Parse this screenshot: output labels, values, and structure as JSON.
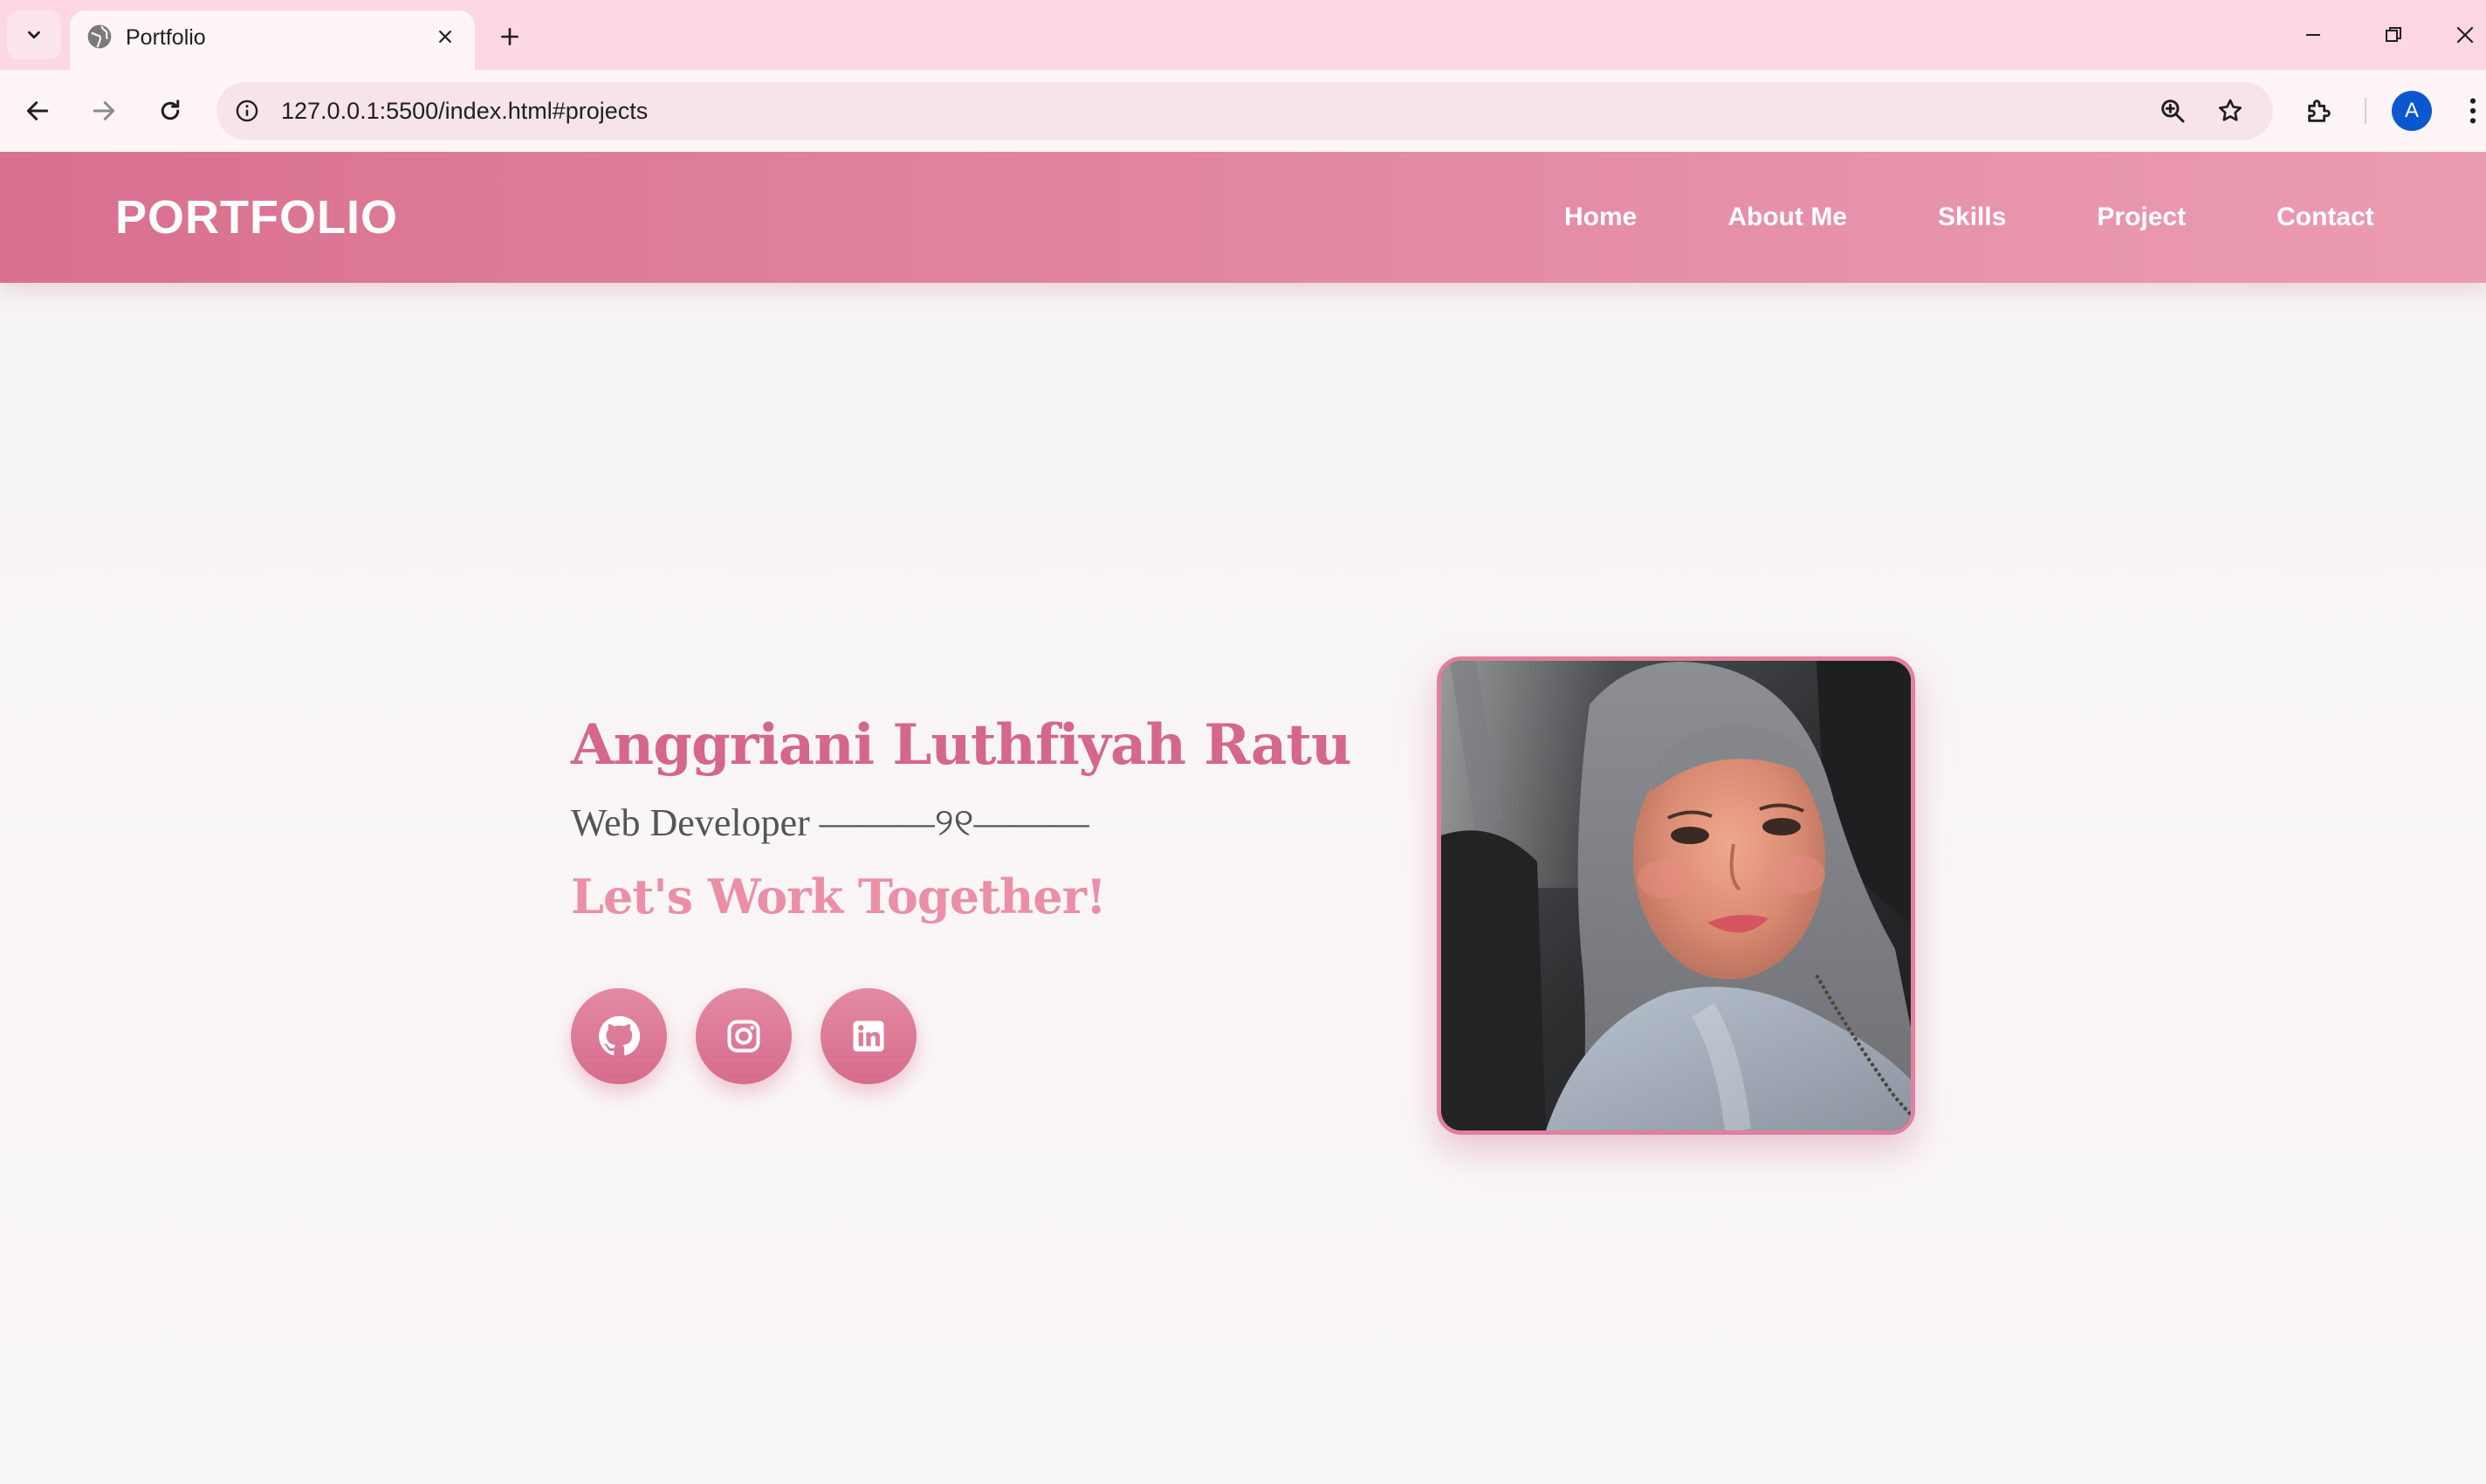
{
  "browser": {
    "tab_title": "Portfolio",
    "url": "127.0.0.1:5500/index.html#projects",
    "profile_initial": "A"
  },
  "site": {
    "logo": "PORTFOLIO",
    "nav": [
      "Home",
      "About Me",
      "Skills",
      "Project",
      "Contact"
    ]
  },
  "hero": {
    "name": "Anggriani Luthfiyah Ratu",
    "role": "Web Developer ———୨୧———",
    "cta": "Let's Work Together!",
    "socials": [
      "github-icon",
      "instagram-icon",
      "linkedin-icon"
    ],
    "photo_alt": "profile photo"
  },
  "colors": {
    "brand_pink": "#d9708f",
    "name_pink": "#d4678a",
    "cta_pink": "#eb8fa8",
    "tabbar": "#fdd7e1"
  }
}
